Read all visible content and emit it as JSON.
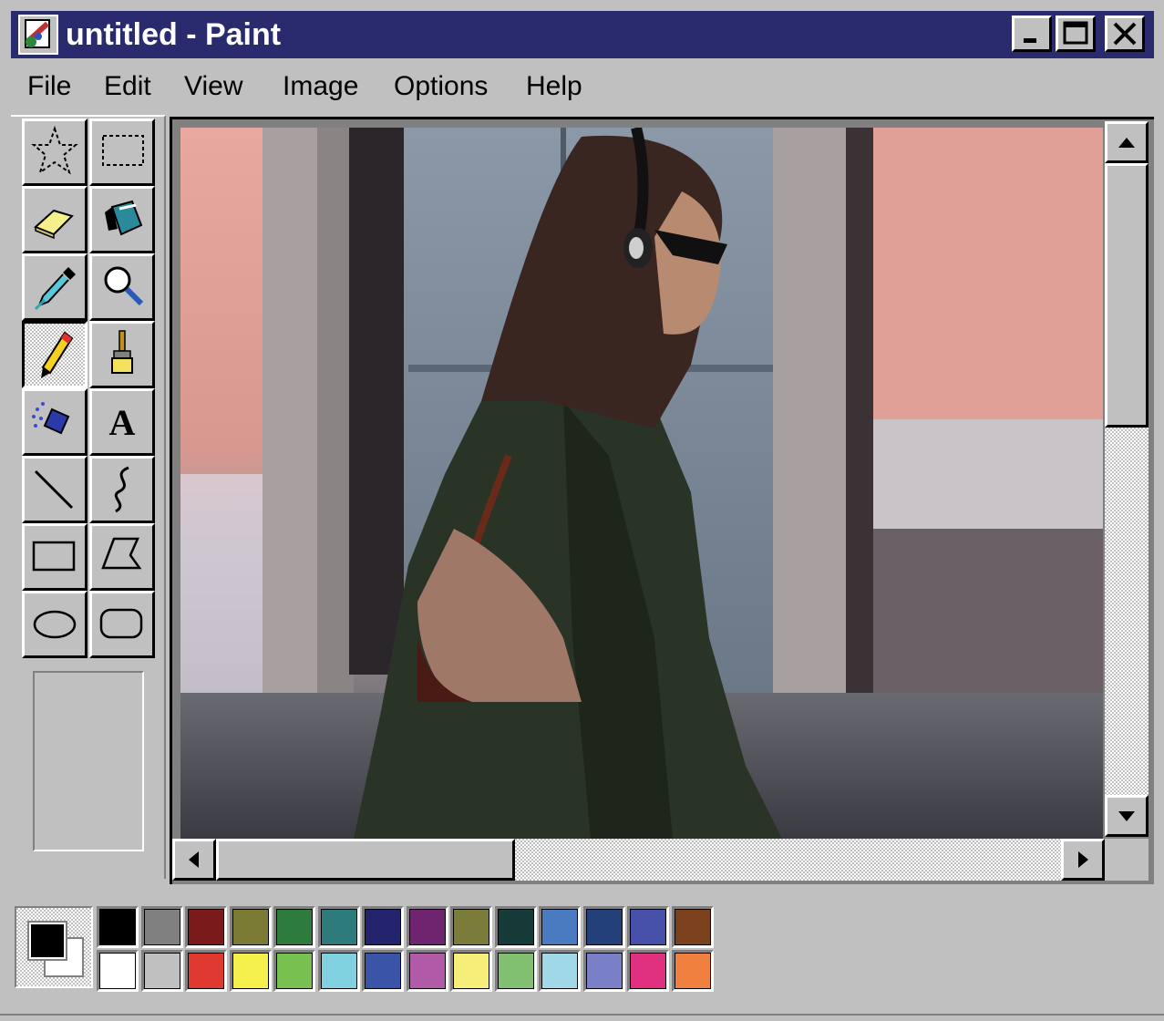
{
  "window": {
    "title": "untitled - Paint"
  },
  "menu": [
    "File",
    "Edit",
    "View",
    "Image",
    "Options",
    "Help"
  ],
  "tools": [
    {
      "name": "free-form-select",
      "icon": "star-select-icon"
    },
    {
      "name": "select",
      "icon": "rect-select-icon"
    },
    {
      "name": "eraser",
      "icon": "eraser-icon"
    },
    {
      "name": "fill-with-color",
      "icon": "paint-bucket-icon"
    },
    {
      "name": "pick-color",
      "icon": "eyedropper-icon"
    },
    {
      "name": "magnifier",
      "icon": "magnifier-icon"
    },
    {
      "name": "pencil",
      "icon": "pencil-icon",
      "active": true
    },
    {
      "name": "brush",
      "icon": "brush-icon"
    },
    {
      "name": "airbrush",
      "icon": "airbrush-icon"
    },
    {
      "name": "text",
      "icon": "text-icon",
      "glyph": "A"
    },
    {
      "name": "line",
      "icon": "line-icon"
    },
    {
      "name": "curve",
      "icon": "curve-icon"
    },
    {
      "name": "rectangle",
      "icon": "rectangle-icon"
    },
    {
      "name": "polygon",
      "icon": "polygon-icon"
    },
    {
      "name": "ellipse",
      "icon": "ellipse-icon"
    },
    {
      "name": "rounded-rectangle",
      "icon": "rounded-rectangle-icon"
    }
  ],
  "colors": {
    "foreground": "#000000",
    "background": "#ffffff",
    "palette_top": [
      "#000000",
      "#808080",
      "#7b1a1a",
      "#7b7b36",
      "#2e7b3e",
      "#2e7b7b",
      "#24246e",
      "#6e246e",
      "#7b7b3a",
      "#153a38",
      "#4a7bc0",
      "#23407b",
      "#4650a8",
      "#7b401c"
    ],
    "palette_bottom": [
      "#ffffff",
      "#c0c0c0",
      "#e03a30",
      "#f5ef4c",
      "#78c050",
      "#80d0e0",
      "#3a54a8",
      "#b05aa8",
      "#f5ef7a",
      "#80c070",
      "#a0d8e8",
      "#7a80c8",
      "#e03080",
      "#f08040"
    ]
  },
  "title_buttons": [
    "minimize-icon",
    "maximize-icon",
    "close-icon"
  ],
  "scroll": {
    "vertical_thumb_fraction": 0.0,
    "horizontal_thumb_fraction": 0.0
  }
}
